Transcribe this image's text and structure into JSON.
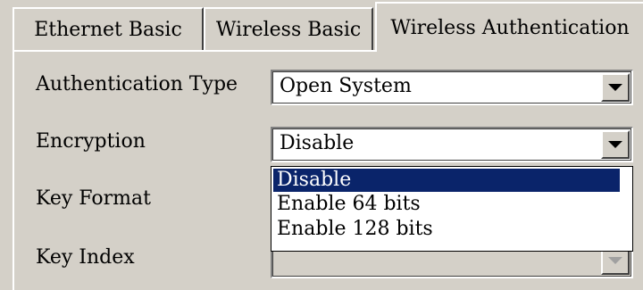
{
  "tabs": [
    {
      "label": "Ethernet Basic"
    },
    {
      "label": "Wireless Basic"
    },
    {
      "label": "Wireless Authentication"
    }
  ],
  "fields": {
    "auth_type": {
      "label": "Authentication Type",
      "value": "Open System"
    },
    "encryption": {
      "label": "Encryption",
      "value": "Disable"
    },
    "key_format": {
      "label": "Key Format",
      "value": ""
    },
    "key_index": {
      "label": "Key Index",
      "value": ""
    }
  },
  "encryption_options": [
    "Disable",
    "Enable 64 bits",
    "Enable 128 bits"
  ],
  "selected_option": "Disable",
  "colors": {
    "face": "#d4d0c8",
    "highlight": "#0a246a"
  }
}
